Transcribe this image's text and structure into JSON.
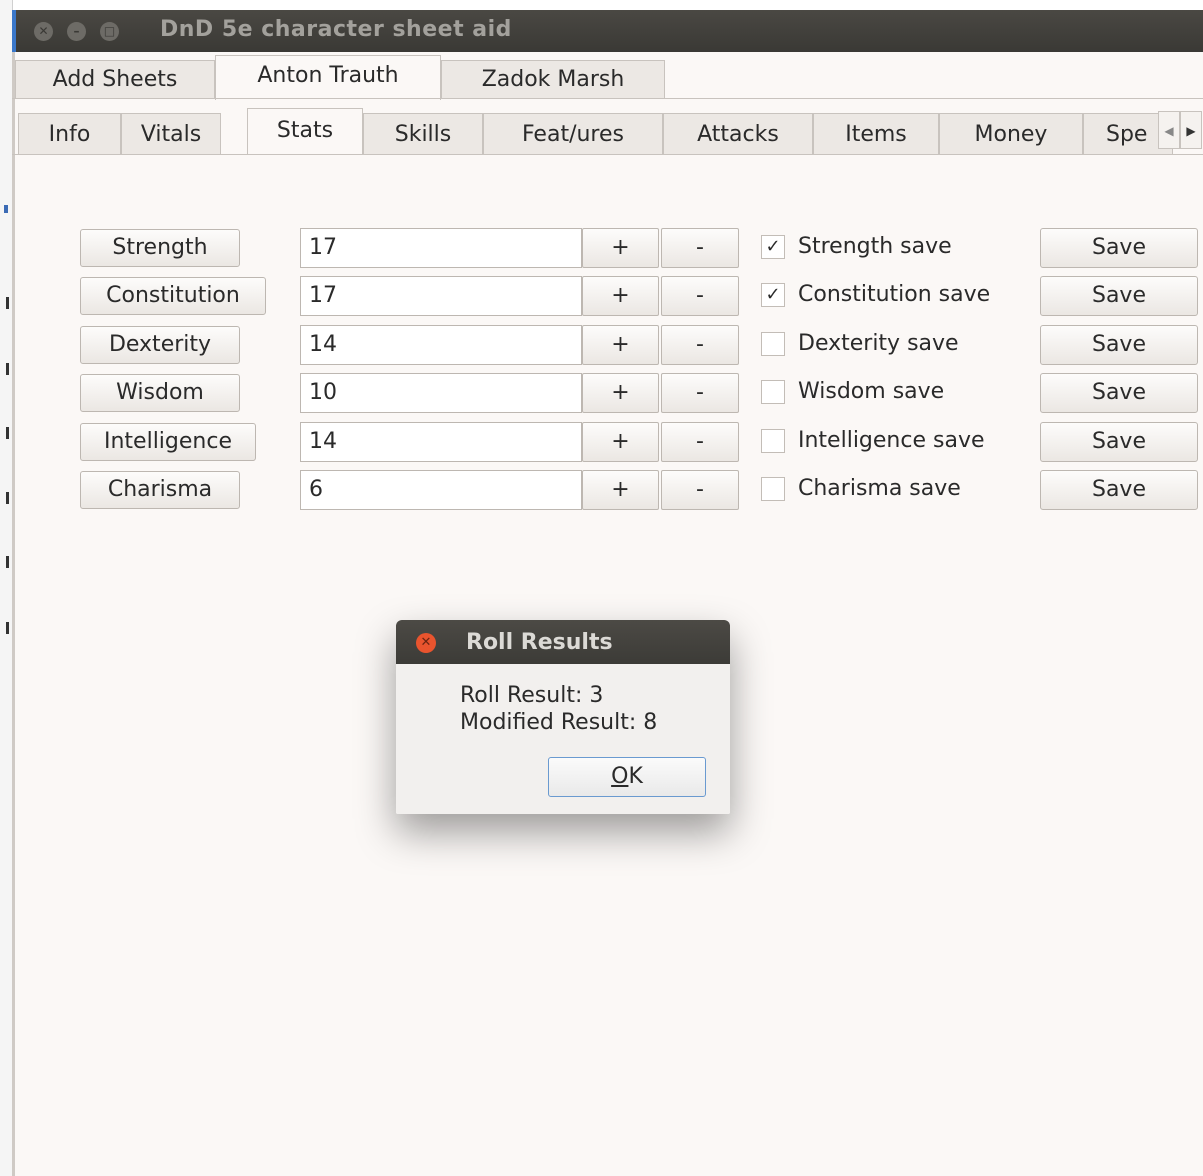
{
  "window": {
    "title": "DnD 5e character sheet aid",
    "controls": [
      "close",
      "minimize",
      "maximize"
    ]
  },
  "sheet_tabs": [
    {
      "label": "Add Sheets",
      "active": false
    },
    {
      "label": "Anton Trauth",
      "active": true
    },
    {
      "label": "Zadok Marsh",
      "active": false
    }
  ],
  "section_tabs": [
    {
      "label": "Info",
      "active": false
    },
    {
      "label": "Vitals",
      "active": false
    },
    {
      "label": "Stats",
      "active": true
    },
    {
      "label": "Skills",
      "active": false
    },
    {
      "label": "Feat/ures",
      "active": false
    },
    {
      "label": "Attacks",
      "active": false
    },
    {
      "label": "Items",
      "active": false
    },
    {
      "label": "Money",
      "active": false
    },
    {
      "label": "Spe",
      "active": false
    }
  ],
  "stats": [
    {
      "name": "Strength",
      "value": "17",
      "save_label": "Strength save",
      "proficient": true
    },
    {
      "name": "Constitution",
      "value": "17",
      "save_label": "Constitution save",
      "proficient": true
    },
    {
      "name": "Dexterity",
      "value": "14",
      "save_label": "Dexterity save",
      "proficient": false
    },
    {
      "name": "Wisdom",
      "value": "10",
      "save_label": "Wisdom save",
      "proficient": false
    },
    {
      "name": "Intelligence",
      "value": "14",
      "save_label": "Intelligence save",
      "proficient": false
    },
    {
      "name": "Charisma",
      "value": "6",
      "save_label": "Charisma save",
      "proficient": false
    }
  ],
  "labels": {
    "plus": "+",
    "minus": "-",
    "save": "Save",
    "check": "✓"
  },
  "dialog": {
    "title": "Roll Results",
    "roll_result": "Roll Result: 3",
    "modified_result": "Modified Result: 8",
    "ok_mnemonic": "O",
    "ok_rest": "K"
  },
  "colors": {
    "titlebar": "#3c3b37",
    "window_bg": "#fbf8f6",
    "close_button": "#e9542e",
    "focus_border": "#6a9ad0"
  }
}
